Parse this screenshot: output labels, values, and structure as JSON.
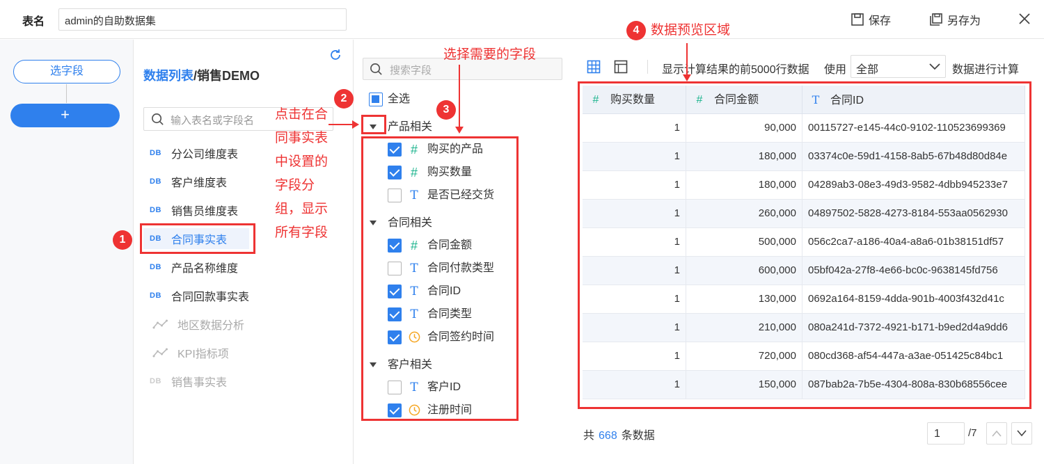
{
  "header": {
    "table_label": "表名",
    "table_name": "admin的自助数据集",
    "save_label": "保存",
    "save_as_label": "另存为"
  },
  "left_panel": {
    "select_fields_label": "选字段",
    "add_label": "+"
  },
  "table_list": {
    "title_link": "数据列表",
    "title_sep": "/",
    "title_current": "销售DEMO",
    "search_placeholder": "输入表名或字段名",
    "items": [
      {
        "icon": "DB",
        "label": "分公司维度表",
        "kind": "db",
        "selected": false
      },
      {
        "icon": "DB",
        "label": "客户维度表",
        "kind": "db",
        "selected": false
      },
      {
        "icon": "DB",
        "label": "销售员维度表",
        "kind": "db",
        "selected": false
      },
      {
        "icon": "DB",
        "label": "合同事实表",
        "kind": "db",
        "selected": true
      },
      {
        "icon": "DB",
        "label": "产品名称维度",
        "kind": "db",
        "selected": false
      },
      {
        "icon": "DB",
        "label": "合同回款事实表",
        "kind": "db",
        "selected": false
      },
      {
        "icon": "link-icon",
        "label": "地区数据分析",
        "kind": "link",
        "selected": false
      },
      {
        "icon": "link-icon",
        "label": "KPI指标项",
        "kind": "link",
        "selected": false
      },
      {
        "icon": "DB",
        "label": "销售事实表",
        "kind": "gray",
        "selected": false
      }
    ]
  },
  "fields": {
    "search_placeholder": "搜索字段",
    "select_all_label": "全选",
    "groups": [
      {
        "label": "产品相关",
        "fields": [
          {
            "type": "#",
            "kind": "num",
            "label": "购买的产品",
            "checked": true
          },
          {
            "type": "#",
            "kind": "num",
            "label": "购买数量",
            "checked": true
          },
          {
            "type": "T",
            "kind": "txt",
            "label": "是否已经交货",
            "checked": false
          }
        ]
      },
      {
        "label": "合同相关",
        "fields": [
          {
            "type": "#",
            "kind": "num",
            "label": "合同金额",
            "checked": true
          },
          {
            "type": "T",
            "kind": "txt",
            "label": "合同付款类型",
            "checked": false
          },
          {
            "type": "T",
            "kind": "txt",
            "label": "合同ID",
            "checked": true
          },
          {
            "type": "T",
            "kind": "txt",
            "label": "合同类型",
            "checked": true
          },
          {
            "type": "clock-icon",
            "kind": "time",
            "label": "合同签约时间",
            "checked": true
          }
        ]
      },
      {
        "label": "客户相关",
        "fields": [
          {
            "type": "T",
            "kind": "txt",
            "label": "客户ID",
            "checked": false
          },
          {
            "type": "clock-icon",
            "kind": "time",
            "label": "注册时间",
            "checked": true
          }
        ]
      }
    ]
  },
  "preview": {
    "info_text": "显示计算结果的前5000行数据",
    "use_label": "使用",
    "scope_value": "全部",
    "calc_label": "数据进行计算",
    "columns": [
      {
        "type": "#",
        "kind": "num",
        "label": "购买数量"
      },
      {
        "type": "#",
        "kind": "num",
        "label": "合同金额"
      },
      {
        "type": "T",
        "kind": "txt",
        "label": "合同ID"
      }
    ],
    "rows": [
      [
        "1",
        "90,000",
        "00115727-e145-44c0-9102-110523699369"
      ],
      [
        "1",
        "180,000",
        "03374c0e-59d1-4158-8ab5-67b48d80d84e"
      ],
      [
        "1",
        "180,000",
        "04289ab3-08e3-49d3-9582-4dbb945233e7"
      ],
      [
        "1",
        "260,000",
        "04897502-5828-4273-8184-553aa0562930"
      ],
      [
        "1",
        "500,000",
        "056c2ca7-a186-40a4-a8a6-01b38151df57"
      ],
      [
        "1",
        "600,000",
        "05bf042a-27f8-4e66-bc0c-9638145fd756"
      ],
      [
        "1",
        "130,000",
        "0692a164-8159-4dda-901b-4003f432d41c"
      ],
      [
        "1",
        "210,000",
        "080a241d-7372-4921-b171-b9ed2d4a9dd6"
      ],
      [
        "1",
        "720,000",
        "080cd368-af54-447a-a3ae-051425c84bc1"
      ],
      [
        "1",
        "150,000",
        "087bab2a-7b5e-4304-808a-830b68556cee"
      ]
    ],
    "total_prefix": "共",
    "total_count": "668",
    "total_suffix": "条数据",
    "page_value": "1",
    "page_total": "/7"
  },
  "annotations": {
    "badge1": "1",
    "badge2": "2",
    "badge3": "3",
    "badge4": "4",
    "note_fields": "选择需要的字段",
    "note_preview": "数据预览区域",
    "note_table_lines": [
      "点击在合",
      "同事实表",
      "中设置的",
      "字段分",
      "组，显示",
      "所有字段"
    ],
    "color": "#e33333"
  },
  "colors": {
    "accent": "#2f80ed",
    "numeric": "#1fb58f",
    "time": "#f5a623"
  }
}
